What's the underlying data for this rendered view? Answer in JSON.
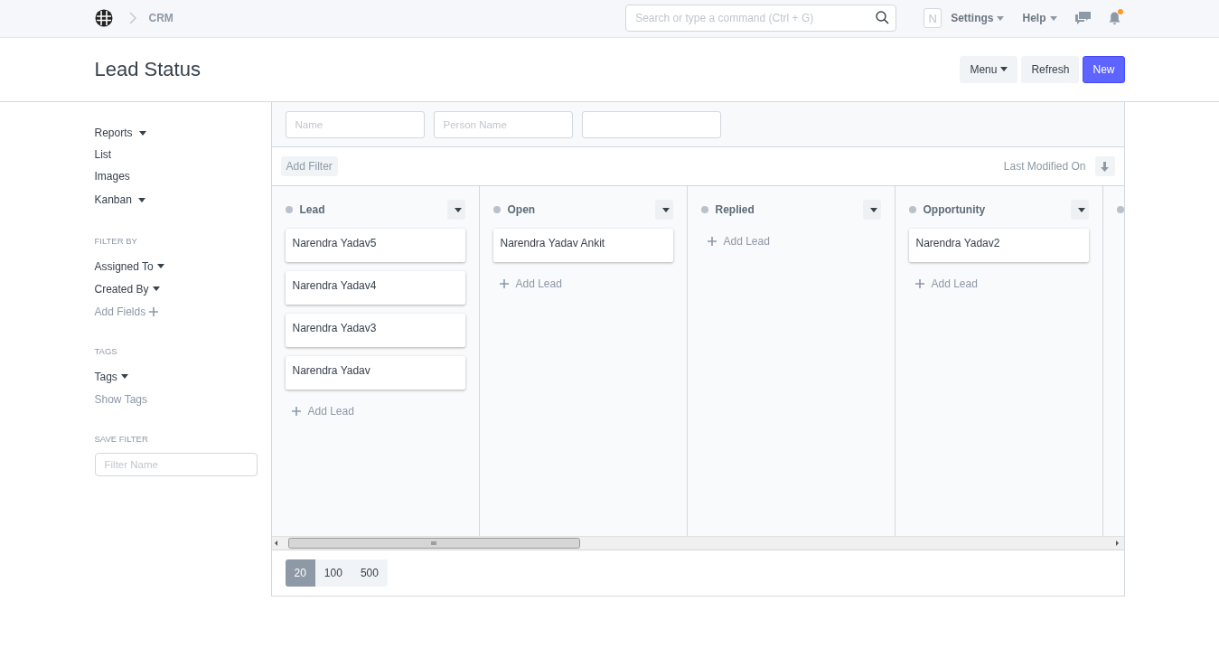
{
  "navbar": {
    "breadcrumb": "CRM",
    "search": {
      "placeholder": "Search or type a command (Ctrl + G)"
    },
    "avatar": "N",
    "menus": [
      "Settings",
      "Help"
    ],
    "notification_unread": true
  },
  "page": {
    "title": "Lead Status",
    "buttons": [
      {
        "label": "Menu",
        "kind": "dropdown"
      },
      {
        "label": "Refresh",
        "kind": "default"
      },
      {
        "label": "New",
        "kind": "primary"
      }
    ]
  },
  "sidebar": {
    "views": [
      {
        "label": "Reports",
        "dropdown": true
      },
      {
        "label": "List",
        "dropdown": false
      },
      {
        "label": "Images",
        "dropdown": false
      },
      {
        "label": "Kanban",
        "dropdown": true
      }
    ],
    "sections": [
      {
        "heading": "FILTER BY",
        "items": [
          {
            "label": "Assigned To",
            "kind": "dropdown"
          },
          {
            "label": "Created By",
            "kind": "dropdown"
          },
          {
            "label": "Add Fields",
            "kind": "add"
          }
        ]
      },
      {
        "heading": "TAGS",
        "items": [
          {
            "label": "Tags",
            "kind": "dropdown"
          },
          {
            "label": "Show Tags",
            "kind": "muted"
          }
        ]
      }
    ],
    "save_filter": {
      "heading": "SAVE FILTER",
      "placeholder": "Filter Name"
    }
  },
  "filters": {
    "fields": [
      {
        "kind": "text",
        "placeholder": "Name"
      },
      {
        "kind": "text",
        "placeholder": "Person Name"
      },
      {
        "kind": "blank"
      }
    ],
    "add_filter": "Add Filter",
    "sort": {
      "label": "Last Modified On",
      "descending": true
    }
  },
  "kanban": {
    "columns": [
      {
        "title": "Lead",
        "cards": [
          "Narendra Yadav5",
          "Narendra Yadav4",
          "Narendra Yadav3",
          "Narendra Yadav"
        ],
        "add_label": "Add Lead"
      },
      {
        "title": "Open",
        "cards": [
          "Narendra Yadav Ankit"
        ],
        "add_label": "Add Lead"
      },
      {
        "title": "Replied",
        "add_label": "Add Lead"
      },
      {
        "title": "Opportunity",
        "cards": [
          "Narendra Yadav2"
        ],
        "add_label": "Add Lead"
      }
    ]
  },
  "paging": [
    {
      "label": "20",
      "selected": true
    },
    {
      "label": "100",
      "selected": false
    },
    {
      "label": "500",
      "selected": false
    }
  ]
}
